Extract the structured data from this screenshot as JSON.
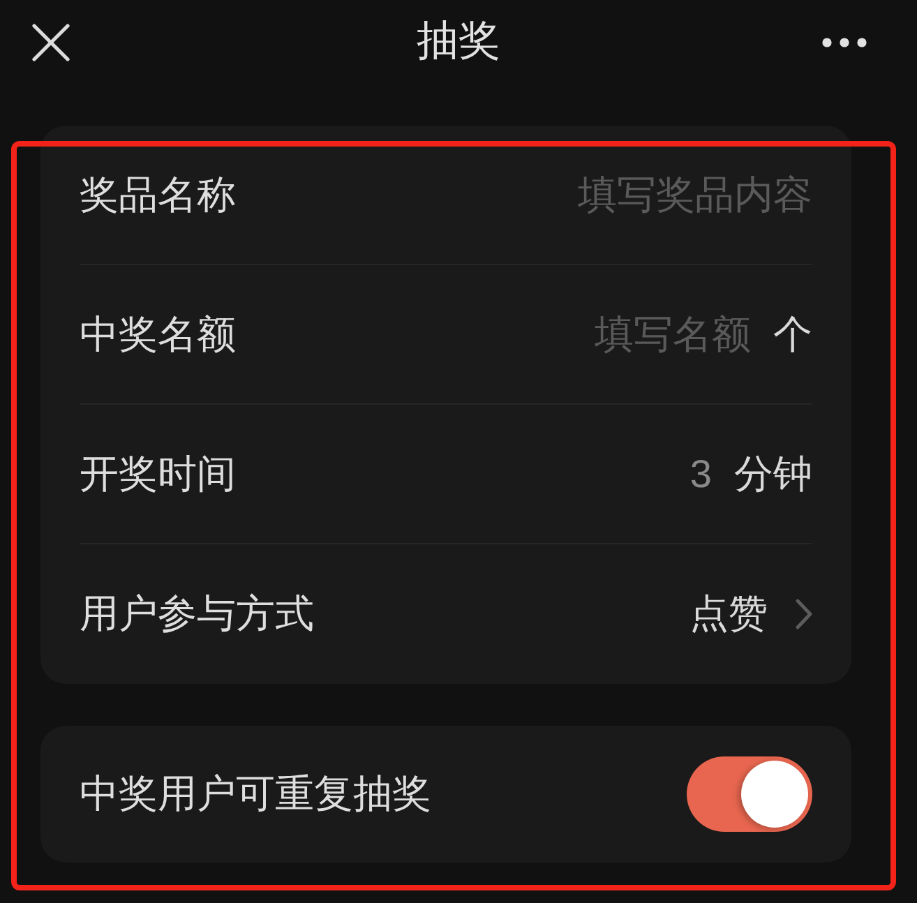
{
  "header": {
    "title": "抽奖"
  },
  "form_rows": [
    {
      "kind": "input",
      "label": "奖品名称",
      "placeholder": "填写奖品内容"
    },
    {
      "kind": "input",
      "label": "中奖名额",
      "placeholder": "填写名额",
      "unit": "个"
    },
    {
      "kind": "input",
      "label": "开奖时间",
      "value": "3",
      "unit": "分钟"
    },
    {
      "kind": "select",
      "label": "用户参与方式",
      "value": "点赞"
    }
  ],
  "toggle_rows": [
    {
      "label": "中奖用户可重复抽奖",
      "on": true
    }
  ]
}
